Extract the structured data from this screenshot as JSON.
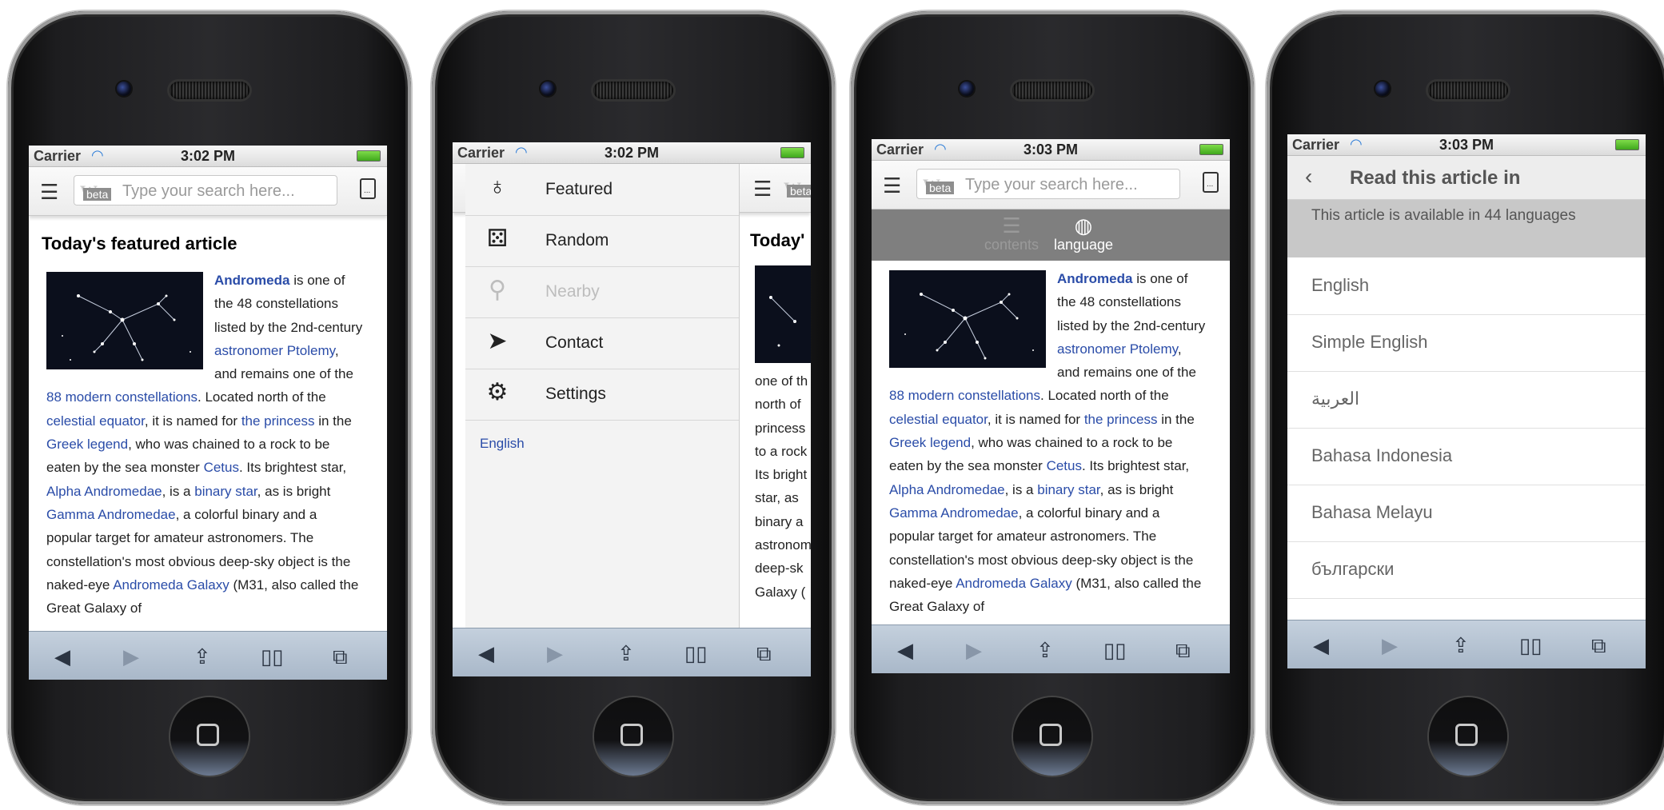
{
  "status": {
    "carrier": "Carrier",
    "wifi_icon": "wifi-icon",
    "times": [
      "3:02 PM",
      "3:02 PM",
      "3:03 PM",
      "3:03 PM"
    ]
  },
  "search": {
    "placeholder": "Type your search here...",
    "beta": "beta",
    "logo": "W"
  },
  "article": {
    "heading": "Today's featured article",
    "heading_partial": "Today'",
    "text": [
      {
        "t": "Andromeda",
        "link": true,
        "bold": true
      },
      {
        "t": " is one of the 48 constellations listed by the 2nd-century "
      },
      {
        "t": "astronomer Ptolemy",
        "link": true
      },
      {
        "t": ", and remains one of the "
      },
      {
        "t": "88 modern constellations",
        "link": true
      },
      {
        "t": ". Located north of the "
      },
      {
        "t": "celestial equator",
        "link": true
      },
      {
        "t": ", it is named for "
      },
      {
        "t": "the princess",
        "link": true
      },
      {
        "t": " in the "
      },
      {
        "t": "Greek legend",
        "link": true
      },
      {
        "t": ", who was chained to a rock to be eaten by the sea monster "
      },
      {
        "t": "Cetus",
        "link": true
      },
      {
        "t": ". Its brightest star, "
      },
      {
        "t": "Alpha Andromedae",
        "link": true
      },
      {
        "t": ", is a "
      },
      {
        "t": "binary star",
        "link": true
      },
      {
        "t": ", as is bright "
      },
      {
        "t": "Gamma Andromedae",
        "link": true
      },
      {
        "t": ", a colorful binary and a popular target for amateur astronomers. The constellation's most obvious deep-sky object is the naked-eye "
      },
      {
        "t": "Andromeda Galaxy",
        "link": true
      },
      {
        "t": " (M31, also called the Great Galaxy of"
      }
    ],
    "partial_lines": [
      "one of th",
      "north of",
      "princess",
      "to a rock",
      "Its bright",
      "star, as",
      "binary a",
      "astronom",
      "deep-sk",
      "Galaxy ("
    ]
  },
  "drawer": {
    "items": [
      {
        "label": "Featured",
        "icon": "ribbon-icon",
        "glyph": "♁",
        "disabled": false
      },
      {
        "label": "Random",
        "icon": "dice-icon",
        "glyph": "⚄",
        "disabled": false
      },
      {
        "label": "Nearby",
        "icon": "location-pin-icon",
        "glyph": "⚲",
        "disabled": true
      },
      {
        "label": "Contact",
        "icon": "paper-plane-icon",
        "glyph": "➤",
        "disabled": false
      },
      {
        "label": "Settings",
        "icon": "gear-icon",
        "glyph": "⚙",
        "disabled": false
      }
    ],
    "language": "English"
  },
  "tabs": [
    {
      "label": "contents",
      "icon": "list-icon",
      "glyph": "☰",
      "active": false
    },
    {
      "label": "language",
      "icon": "globe-icon",
      "glyph": "◍",
      "active": true
    }
  ],
  "language_screen": {
    "title": "Read this article in",
    "note": "This article is available in 44 languages",
    "languages": [
      "English",
      "Simple English",
      "العربية",
      "Bahasa Indonesia",
      "Bahasa Melayu",
      "български"
    ]
  },
  "toolbar": [
    {
      "icon": "back-arrow-icon",
      "glyph": "◀"
    },
    {
      "icon": "forward-arrow-icon",
      "glyph": "▶"
    },
    {
      "icon": "share-icon",
      "glyph": "⇪"
    },
    {
      "icon": "bookmarks-icon",
      "glyph": "📖"
    },
    {
      "icon": "tabs-icon",
      "glyph": "⧉"
    }
  ]
}
